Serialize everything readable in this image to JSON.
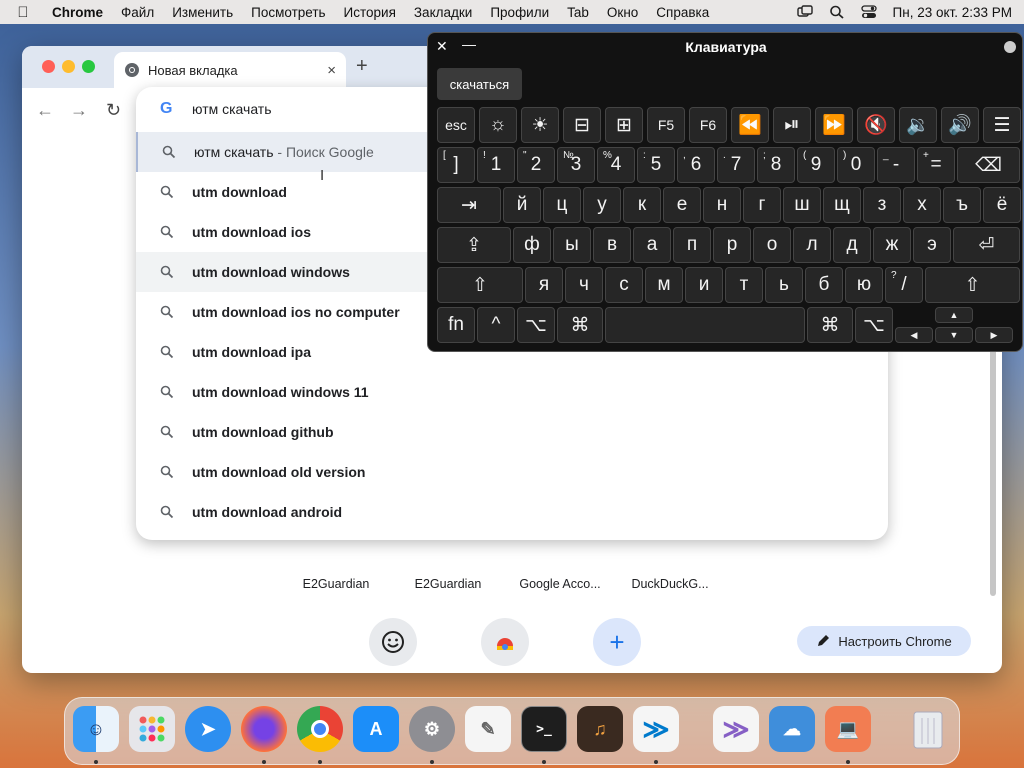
{
  "menubar": {
    "app": "Chrome",
    "items": [
      "Файл",
      "Изменить",
      "Посмотреть",
      "История",
      "Закладки",
      "Профили",
      "Tab",
      "Окно",
      "Справка"
    ],
    "datetime": "Пн, 23 окт.  2:33 PM"
  },
  "browser": {
    "tab_title": "Новая вкладка",
    "new_tab": "+",
    "close_tab": "×"
  },
  "omnibox": {
    "query": "ютм скачать",
    "suggestions": [
      {
        "text": "ютм скачать",
        "suffix": " - Поиск Google"
      },
      {
        "text": "utm download"
      },
      {
        "text": "utm download ios"
      },
      {
        "text": "utm download windows"
      },
      {
        "text": "utm download ios no computer"
      },
      {
        "text": "utm download ipa"
      },
      {
        "text": "utm download windows 11"
      },
      {
        "text": "utm download github"
      },
      {
        "text": "utm download old version"
      },
      {
        "text": "utm download android"
      }
    ]
  },
  "ntp": {
    "shortcuts": [
      "E2Guardian",
      "E2Guardian",
      "Google Acco...",
      "DuckDuckG..."
    ],
    "customize": "Настроить Chrome"
  },
  "keyboard": {
    "title": "Клавиатура",
    "prediction": "скачаться",
    "fn_row": [
      "esc",
      "F5",
      "F6"
    ],
    "num_row": [
      {
        "main": "]",
        "sub": "["
      },
      {
        "main": "1",
        "sub": "!"
      },
      {
        "main": "2",
        "sub": "\""
      },
      {
        "main": "3",
        "sub": "№"
      },
      {
        "main": "4",
        "sub": "%"
      },
      {
        "main": "5",
        "sub": ":"
      },
      {
        "main": "6",
        "sub": ","
      },
      {
        "main": "7",
        "sub": "."
      },
      {
        "main": "8",
        "sub": ";"
      },
      {
        "main": "9",
        "sub": "("
      },
      {
        "main": "0",
        "sub": ")"
      },
      {
        "main": "-",
        "sub": "_"
      },
      {
        "main": "=",
        "sub": "+"
      }
    ],
    "row1": [
      "й",
      "ц",
      "у",
      "к",
      "е",
      "н",
      "г",
      "ш",
      "щ",
      "з",
      "х",
      "ъ",
      "ё"
    ],
    "row2": [
      "ф",
      "ы",
      "в",
      "а",
      "п",
      "р",
      "о",
      "л",
      "д",
      "ж",
      "э"
    ],
    "row3": [
      "я",
      "ч",
      "с",
      "м",
      "и",
      "т",
      "ь",
      "б",
      "ю"
    ],
    "slash": {
      "main": "/",
      "sub": "?"
    },
    "fn": "fn"
  },
  "colors": {
    "accent_blue": "#1a73e8",
    "keyboard_bg": "#121212",
    "omnibox_selected": "#e9edf3"
  }
}
